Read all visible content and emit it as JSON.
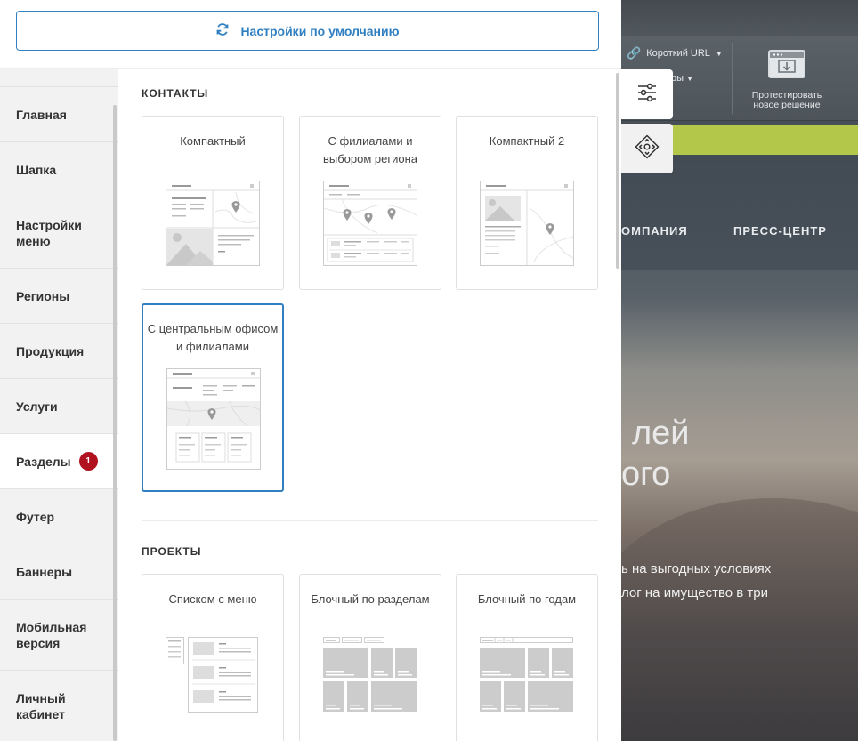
{
  "reset": {
    "label": "Настройки по умолчанию",
    "icon": "refresh-icon"
  },
  "sidebar": {
    "items": [
      {
        "label": "Главная"
      },
      {
        "label": "Шапка"
      },
      {
        "label": "Настройки меню"
      },
      {
        "label": "Регионы"
      },
      {
        "label": "Продукция"
      },
      {
        "label": "Услуги"
      },
      {
        "label": "Разделы",
        "badge": "1",
        "active": true
      },
      {
        "label": "Футер"
      },
      {
        "label": "Баннеры"
      },
      {
        "label": "Мобильная версия"
      },
      {
        "label": "Личный кабинет"
      }
    ]
  },
  "sections": {
    "contacts": {
      "title": "КОНТАКТЫ",
      "cards": [
        {
          "label": "Компактный"
        },
        {
          "label": "С филиалами и выбором региона"
        },
        {
          "label": "Компактный 2"
        },
        {
          "label": "С центральным офисом и филиалами",
          "selected": true
        }
      ]
    },
    "projects": {
      "title": "ПРОЕКТЫ",
      "cards": [
        {
          "label": "Списком с меню"
        },
        {
          "label": "Блочный по разделам"
        },
        {
          "label": "Блочный по годам"
        }
      ]
    }
  },
  "background": {
    "short_url": "Короткий URL",
    "filters_fragment": "ры",
    "test_button": "Протестировать новое решение",
    "nav_company": "ОМПАНИЯ",
    "nav_press": "ПРЕСС-ЦЕНТР",
    "hero_line1": "лей",
    "hero_line2": "ого",
    "text_line1": "ь на выгодных условиях",
    "text_line2": "лог на имущество в три"
  },
  "colors": {
    "accent": "#2f7fc1",
    "badge": "#b0121f",
    "green_bar": "#b3c84a"
  }
}
